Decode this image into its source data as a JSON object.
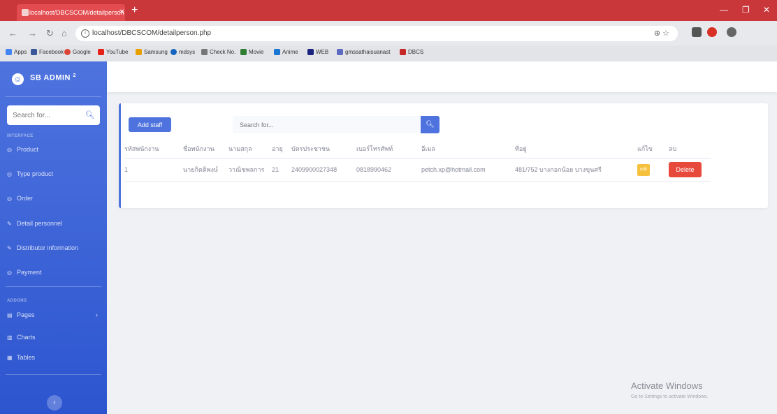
{
  "browser": {
    "tab_title": "localhost/DBCSCOM/detailperson",
    "url": "localhost/DBCSCOM/detailperson.php",
    "bookmarks": [
      {
        "label": "Apps",
        "color": "#4285f4"
      },
      {
        "label": "Facebook",
        "color": "#3b5998"
      },
      {
        "label": "Google",
        "color": "#db4437"
      },
      {
        "label": "YouTube",
        "color": "#e62117"
      },
      {
        "label": "Samsung",
        "color": "#e8a000"
      },
      {
        "label": "mdsys",
        "color": "#1565c0"
      },
      {
        "label": "Check No.",
        "color": "#777777"
      },
      {
        "label": "Movie",
        "color": "#2e7d32"
      },
      {
        "label": "Anime",
        "color": "#1976d2"
      },
      {
        "label": "WEB",
        "color": "#1a237e"
      },
      {
        "label": "gmssathaisuanast",
        "color": "#5c6bc0"
      },
      {
        "label": "DBCS",
        "color": "#c62828"
      }
    ]
  },
  "sidebar": {
    "brand": "SB ADMIN",
    "brand_sup": "2",
    "search_placeholder": "Search for...",
    "heading_interface": "INTERFACE",
    "heading_addons": "ADDONS",
    "items": [
      {
        "label": "Product",
        "icon": "◎"
      },
      {
        "label": "Type product",
        "icon": "◎"
      },
      {
        "label": "Order",
        "icon": "◎"
      },
      {
        "label": "Detail personnel",
        "icon": "✎"
      },
      {
        "label": "Distributor information",
        "icon": "✎"
      },
      {
        "label": "Payment",
        "icon": "◎"
      }
    ],
    "addons": [
      {
        "label": "Pages",
        "icon": "▤"
      },
      {
        "label": "Charts",
        "icon": "▥"
      },
      {
        "label": "Tables",
        "icon": "▦"
      }
    ]
  },
  "card": {
    "add_button": "Add staff",
    "search_placeholder": "Search for..."
  },
  "table": {
    "columns": [
      "รหัสพนักงาน",
      "ชื่อพนักงาน",
      "นามสกุล",
      "อายุ",
      "บัตรประชาชน",
      "เบอร์โทรศัพท์",
      "อีเมล",
      "ที่อยู่",
      "แก้ไข",
      "ลบ"
    ],
    "rows": [
      [
        "1",
        "นายกิตติพงษ์",
        "วาณิชพลการ",
        "21",
        "2409900027348",
        "0818990462",
        "petch.xp@hotmail.com",
        "481/752 บางกอกน้อย บางขุนศรี",
        "edit",
        "Delete"
      ]
    ]
  },
  "watermark": {
    "title": "Activate Windows",
    "subtitle": "Go to Settings to activate Windows."
  }
}
